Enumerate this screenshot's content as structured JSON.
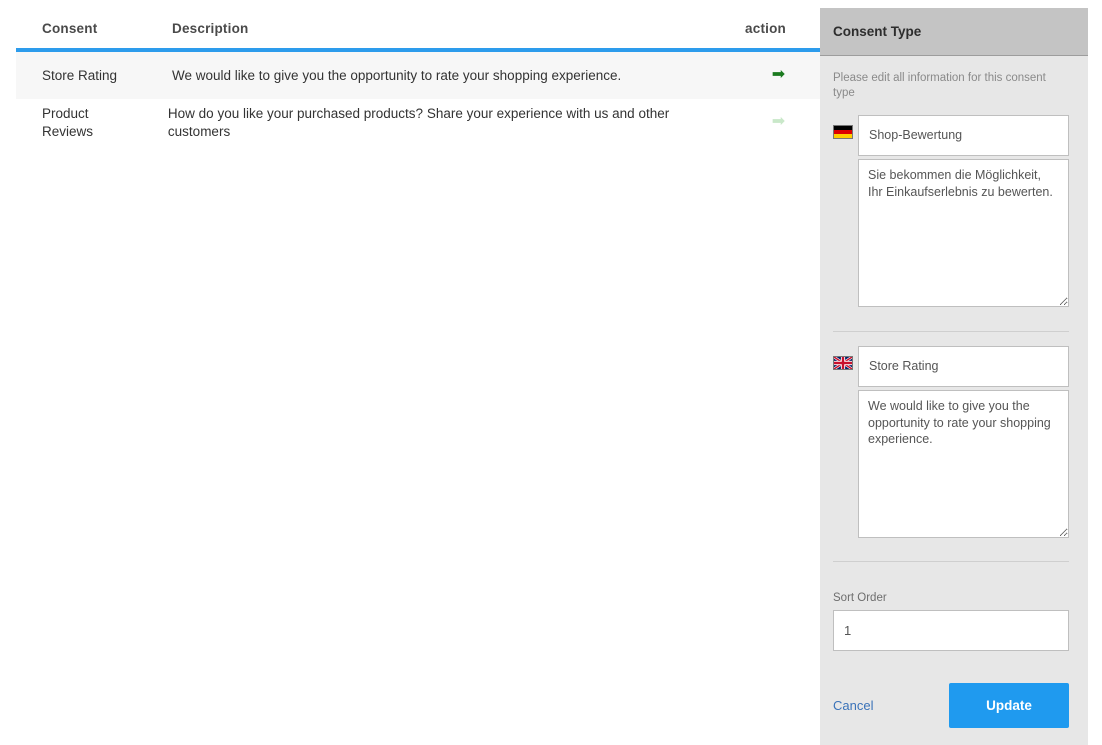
{
  "table": {
    "columns": [
      {
        "key": "consent",
        "label": "Consent"
      },
      {
        "key": "description",
        "label": "Description"
      },
      {
        "key": "action",
        "label": "action"
      }
    ],
    "rows": [
      {
        "consent": "Store Rating",
        "description": "We would like to give you the opportunity to rate your shopping experience.",
        "action_icon": "arrow-right-icon",
        "selected": true
      },
      {
        "consent": "Product Reviews",
        "description": "How do you like your purchased products? Share your experience with us and other customers",
        "action_icon": "arrow-right-icon",
        "selected": false
      }
    ],
    "accent_color": "#2d9cec",
    "selected_row_color": "#f7f7f7",
    "action_icon_color": "#1a7a1e",
    "action_icon_muted_color": "#c9e8c9",
    "action_glyph": "➡"
  },
  "panel": {
    "title": "Consent Type",
    "subtitle": "Please edit all information for this consent type",
    "header_bg": "#c4c4c4",
    "body_bg": "#e7e7e7",
    "languages": [
      {
        "flag": "de-flag-icon",
        "flag_label": "German",
        "name_value": "Shop-Bewertung",
        "name_placeholder": "",
        "description_value": "Sie bekommen die Möglichkeit, Ihr Einkaufserlebnis zu bewerten.",
        "description_placeholder": ""
      },
      {
        "flag": "gb-flag-icon",
        "flag_label": "English",
        "name_value": "Store Rating",
        "name_placeholder": "",
        "description_value": "We would like to give you the opportunity to rate your shopping experience.",
        "description_placeholder": ""
      }
    ],
    "sort_order": {
      "label": "Sort Order",
      "value": "1",
      "placeholder": ""
    },
    "cancel_label": "Cancel",
    "update_label": "Update",
    "update_color": "#1f9aef",
    "cancel_color": "#3b73b9"
  }
}
